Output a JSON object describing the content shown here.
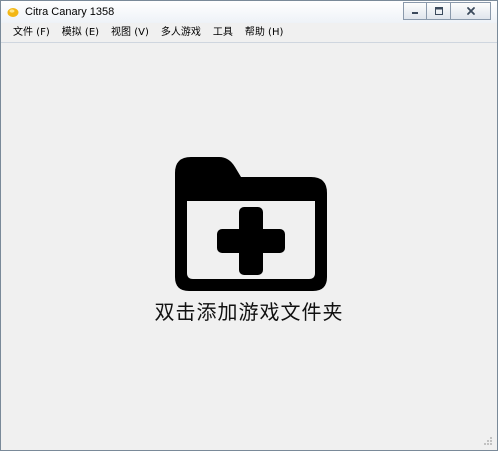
{
  "window": {
    "title": "Citra Canary 1358",
    "icon": "citra-app-icon"
  },
  "controls": {
    "minimize_icon": "minimize-icon",
    "maximize_icon": "maximize-icon",
    "close_icon": "close-icon"
  },
  "menu": {
    "items": [
      {
        "label": "文件 (F)"
      },
      {
        "label": "模拟 (E)"
      },
      {
        "label": "视图 (V)"
      },
      {
        "label": "多人游戏"
      },
      {
        "label": "工具"
      },
      {
        "label": "帮助 (H)"
      }
    ]
  },
  "main": {
    "folder_icon": "add-folder-icon",
    "hint": "双击添加游戏文件夹"
  },
  "colors": {
    "background": "#f0f0f0",
    "icon": "#000000"
  }
}
